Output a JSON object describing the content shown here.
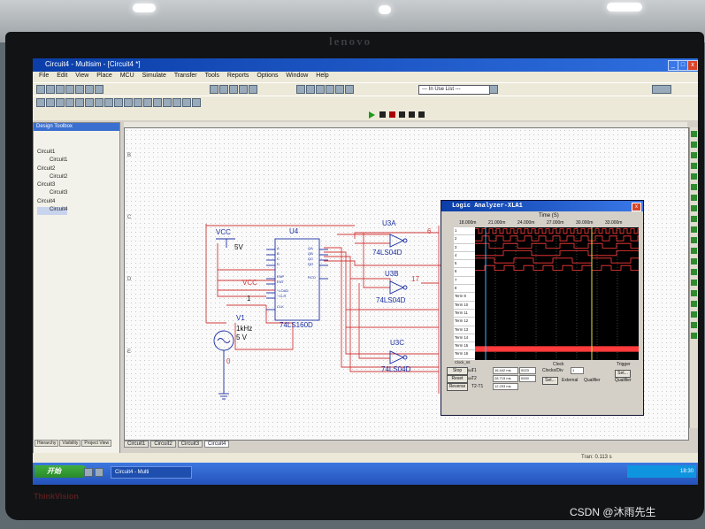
{
  "window": {
    "title": "Circuit4 - Multisim - [Circuit4 *]",
    "minimize": "_",
    "maximize": "□",
    "close": "x"
  },
  "monitor": {
    "brand": "lenovo",
    "bezel_label": "ThinkVision"
  },
  "menu": [
    "File",
    "Edit",
    "View",
    "Place",
    "MCU",
    "Simulate",
    "Transfer",
    "Tools",
    "Reports",
    "Options",
    "Window",
    "Help"
  ],
  "toolbar": {
    "in_use_list": "--- In Use List ---"
  },
  "design_toolbox": {
    "title": "Design Toolbox",
    "tree": [
      {
        "label": "Circuit1",
        "child": "Circuit1"
      },
      {
        "label": "Circuit2",
        "child": "Circuit2"
      },
      {
        "label": "Circuit3",
        "child": "Circuit3"
      },
      {
        "label": "Circuit4",
        "child": "Circuit4"
      }
    ],
    "tabs": [
      "Hierarchy",
      "Visibility",
      "Project View"
    ]
  },
  "schematic": {
    "row_labels": [
      "B",
      "C",
      "D",
      "E"
    ],
    "vcc_label": "VCC",
    "vcc_value": "5V",
    "vcc_label2": "VCC",
    "u4": "U4",
    "u4_part": "74LS160D",
    "u4_pins_left": [
      "A",
      "B",
      "C",
      "D",
      "ENP",
      "ENT",
      "~LOAD",
      "~CLR",
      "CLK"
    ],
    "u4_pins_right": [
      "QA",
      "QB",
      "QC",
      "QD",
      "RCO"
    ],
    "v1": "V1",
    "v1_freq": "1kHz",
    "v1_amp": "5 V",
    "net_1": "1",
    "net_0": "0",
    "u3a": "U3A",
    "u3a_part": "74LS04D",
    "u3b": "U3B",
    "u3b_part": "74LS04D",
    "u3c": "U3C",
    "u3c_part": "74LS04D",
    "net_6": "6",
    "net_17": "17"
  },
  "logic_analyzer": {
    "title": "Logic Analyzer-XLA1",
    "time_label": "Time (S)",
    "ticks": [
      "18.000m",
      "21.000m",
      "24.000m",
      "27.000m",
      "30.000m",
      "33.000m"
    ],
    "channels": [
      "1",
      "2",
      "3",
      "4",
      "5",
      "6",
      "7",
      "8",
      "Term 9",
      "Term 10",
      "Term 11",
      "Term 12",
      "Term 13",
      "Term 14",
      "Term 15",
      "Term 16",
      "Clock_Int",
      "Clock_Qua",
      "Trigg_Qua"
    ],
    "buttons": {
      "stop": "Stop",
      "reset": "Reset",
      "reverse": "Reverse",
      "set_clock": "Set...",
      "set_trigger": "Set..."
    },
    "t_labels": [
      "T1",
      "T2",
      "T2-T1"
    ],
    "t_values": [
      "16.442 ms",
      "28.715 ms",
      "12.293 ms"
    ],
    "t_values2": [
      "0023",
      "0000"
    ],
    "clock_label": "Clock",
    "clocks_div_label": "Clocks/Div",
    "clocks_div_value": "1",
    "external": "External",
    "qualifier": "Qualifier",
    "trigger_label": "Trigger"
  },
  "sheet_tabs": [
    "Circuit1",
    "Circuit2",
    "Circuit3",
    "Circuit4"
  ],
  "statusbar": {
    "tran": "Tran: 0.113 s"
  },
  "taskbar": {
    "start": "开始",
    "task": "Circuit4 - Multi",
    "clock": "18:30"
  },
  "watermark": "CSDN @沐雨先生",
  "colors": {
    "titlebar": "#0b3ea8",
    "wire": "#d23a3a",
    "component": "#1a2ea0",
    "trace": "#ff3b3b",
    "cursor": "#e8e14a"
  }
}
